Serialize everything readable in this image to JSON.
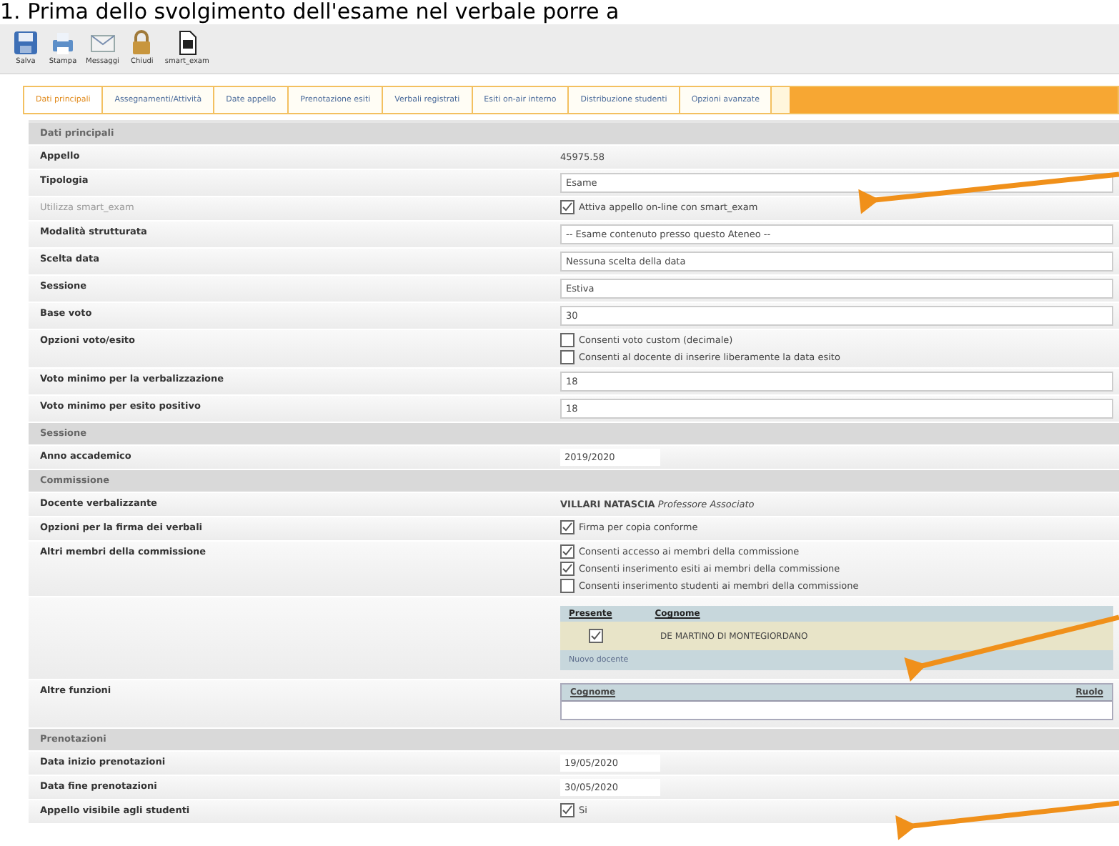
{
  "heading": "1. Prima dello svolgimento dell'esame nel verbale porre a",
  "toolbar": [
    {
      "kind": "save",
      "label": "Salva"
    },
    {
      "kind": "print",
      "label": "Stampa"
    },
    {
      "kind": "mail",
      "label": "Messaggi"
    },
    {
      "kind": "lock",
      "label": "Chiudi"
    },
    {
      "kind": "doc",
      "label": "smart_exam"
    }
  ],
  "tabs": [
    {
      "label": "Dati principali",
      "selected": true
    },
    {
      "label": "Assegnamenti/Attività",
      "selected": false
    },
    {
      "label": "Date appello",
      "selected": false
    },
    {
      "label": "Prenotazione esiti",
      "selected": false
    },
    {
      "label": "Verbali registrati",
      "selected": false
    },
    {
      "label": "Esiti on-air interno",
      "selected": false
    },
    {
      "label": "Distribuzione studenti",
      "selected": false
    },
    {
      "label": "Opzioni avanzate",
      "selected": false
    }
  ],
  "rows": [
    {
      "kind": "section",
      "label": "Dati principali"
    },
    {
      "kind": "text",
      "label": "Appello",
      "value": "45975.58"
    },
    {
      "kind": "field",
      "label": "Tipologia",
      "value": "Esame"
    },
    {
      "kind": "checks",
      "label": "Utilizza smart_exam",
      "disabled": true,
      "options": [
        {
          "label": "Attiva appello on-line con smart_exam",
          "checked": true
        }
      ]
    },
    {
      "kind": "field",
      "label": "Modalità strutturata",
      "value": "-- Esame contenuto presso questo Ateneo --"
    },
    {
      "kind": "field",
      "label": "Scelta data",
      "value": "Nessuna scelta della data"
    },
    {
      "kind": "field",
      "label": "Sessione",
      "value": "Estiva"
    },
    {
      "kind": "field",
      "label": "Base voto",
      "value": "30"
    },
    {
      "kind": "checks",
      "label": "Opzioni voto/esito",
      "disabled": false,
      "options": [
        {
          "label": "Consenti voto custom (decimale)",
          "checked": false
        },
        {
          "label": "Consenti al docente di inserire liberamente la data esito",
          "checked": false
        }
      ]
    },
    {
      "kind": "field",
      "label": "Voto minimo per la verbalizzazione",
      "value": "18"
    },
    {
      "kind": "field",
      "label": "Voto minimo per esito positivo",
      "value": "18"
    },
    {
      "kind": "section",
      "label": "Sessione"
    },
    {
      "kind": "short",
      "label": "Anno accademico",
      "value": "2019/2020"
    },
    {
      "kind": "section",
      "label": "Commissione"
    },
    {
      "kind": "person",
      "label": "Docente verbalizzante",
      "name": "VILLARI NATASCIA",
      "role": "Professore Associato"
    },
    {
      "kind": "checks",
      "label": "Opzioni per la firma dei verbali",
      "disabled": false,
      "options": [
        {
          "label": "Firma per copia conforme",
          "checked": true
        }
      ]
    },
    {
      "kind": "checks",
      "label": "Altri membri della commissione",
      "disabled": false,
      "options": [
        {
          "label": "Consenti accesso ai membri della commissione",
          "checked": true
        },
        {
          "label": "Consenti inserimento esiti ai membri della commissione",
          "checked": true
        },
        {
          "label": "Consenti inserimento studenti ai membri della commissione",
          "checked": false
        }
      ]
    },
    {
      "kind": "members",
      "columns": [
        "Presente",
        "Cognome"
      ],
      "members": [
        {
          "name": "DE MARTINO DI MONTEGIORDANO",
          "checked": true
        }
      ],
      "link": "Nuovo docente"
    },
    {
      "kind": "table",
      "label": "Altre funzioni",
      "columns": [
        "Cognome",
        "Ruolo"
      ]
    },
    {
      "kind": "section",
      "label": "Prenotazioni"
    },
    {
      "kind": "short",
      "label": "Data inizio prenotazioni",
      "value": "19/05/2020"
    },
    {
      "kind": "short",
      "label": "Data fine prenotazioni",
      "value": "30/05/2020"
    },
    {
      "kind": "checks",
      "label": "Appello visibile agli studenti",
      "disabled": false,
      "options": [
        {
          "label": "Si",
          "checked": true
        }
      ]
    }
  ]
}
